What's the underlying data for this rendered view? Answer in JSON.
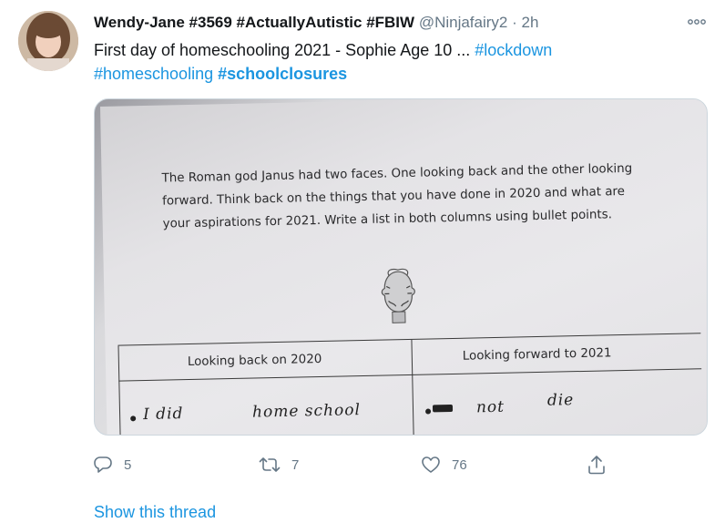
{
  "tweet": {
    "display_name": "Wendy-Jane #3569 #ActuallyAutistic #FBIW",
    "handle": "@Ninjafairy2",
    "separator": "·",
    "time": "2h",
    "text_plain": "First day of homeschooling 2021 - Sophie Age 10 ... ",
    "hashtag_1": "#lockdown",
    "hashtag_2": "#homeschooling",
    "hashtag_3": "#schoolclosures"
  },
  "media": {
    "instructions": "The Roman god Janus had two faces. One looking back and the other looking forward. Think back on the things that you have done in 2020 and what are your aspirations for 2021. Write a list in both columns using bullet points.",
    "col_left_header": "Looking back on 2020",
    "col_right_header": "Looking forward to 2021",
    "left_entry_1": "I did",
    "left_entry_2": "home school",
    "right_entry_1": "not",
    "right_entry_2": "die"
  },
  "actions": {
    "replies": "5",
    "retweets": "7",
    "likes": "76"
  },
  "footer": {
    "show_thread": "Show this thread"
  },
  "colors": {
    "link": "#1b95e0",
    "secondary": "#657786"
  },
  "icons": [
    "more-icon",
    "reply-icon",
    "retweet-icon",
    "like-icon",
    "share-icon"
  ]
}
